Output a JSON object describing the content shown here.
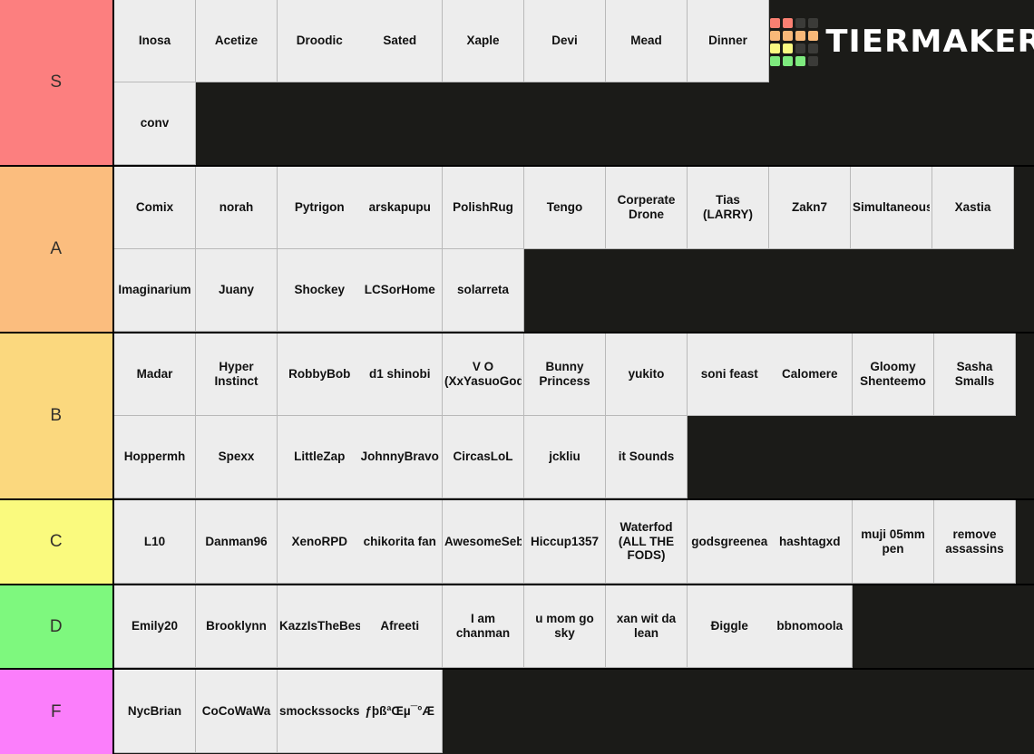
{
  "app": {
    "name": "TierMaker",
    "logo_word": "TIERMAKER",
    "background_color": "#1b1b18",
    "cell_color": "#ededed",
    "logo_icon": "tiermaker-grid-logo"
  },
  "logo_grid_colors": [
    "#fa8072",
    "#fa8072",
    "#3b3b38",
    "#3b3b38",
    "#f8b878",
    "#f8b878",
    "#f8b878",
    "#f8b878",
    "#fafa82",
    "#fafa82",
    "#3b3b38",
    "#3b3b38",
    "#7eea7e",
    "#7eea7e",
    "#7eea7e",
    "#3b3b38"
  ],
  "tiers": [
    {
      "label": "S",
      "color": "#fc7f7f",
      "rows": [
        [
          {
            "text": "Inosa",
            "span": 1
          },
          {
            "text": "Acetize",
            "span": 1
          },
          {
            "text": "Droodic",
            "span": 1
          },
          {
            "text": "Sated",
            "span": 1
          },
          {
            "text": "Xaple",
            "span": 1
          },
          {
            "text": "Devi",
            "span": 1
          },
          {
            "text": "Mead",
            "span": 1
          },
          {
            "text": "Dinner",
            "span": 1
          }
        ],
        [
          {
            "text": "conv",
            "span": 1
          }
        ]
      ]
    },
    {
      "label": "A",
      "color": "#fbbd7e",
      "rows": [
        [
          {
            "text": "Comix",
            "span": 1
          },
          {
            "text": "norah",
            "span": 1
          },
          {
            "text": "Pytrigon",
            "span": 1
          },
          {
            "text": "arskapupu",
            "span": 1
          },
          {
            "text": "PolishRug",
            "span": 1
          },
          {
            "text": "Tengo",
            "span": 1
          },
          {
            "text": "Corperate Drone",
            "span": 1
          },
          {
            "text": "Tias (LARRY)",
            "span": 1
          },
          {
            "text": "Zakn7",
            "span": 1
          },
          {
            "text": "Simultaneous",
            "span": 1
          },
          {
            "text": "Xastia",
            "span": 1
          }
        ],
        [
          {
            "text": "Imaginarium",
            "span": 1
          },
          {
            "text": "Juany",
            "span": 1
          },
          {
            "text": "Shockey",
            "span": 1
          },
          {
            "text": "LCSorHome",
            "span": 1
          },
          {
            "text": "solarreta",
            "span": 1
          }
        ]
      ]
    },
    {
      "label": "B",
      "color": "#fbd87e",
      "rows": [
        [
          {
            "text": "Madar",
            "span": 1
          },
          {
            "text": "Hyper Instinct",
            "span": 1
          },
          {
            "text": "RobbyBob",
            "span": 1
          },
          {
            "text": "d1 shinobi",
            "span": 1
          },
          {
            "text": "V O (XxYasuoGod",
            "span": 1
          },
          {
            "text": "Bunny Princess",
            "span": 1
          },
          {
            "text": "yukito",
            "span": 1
          },
          {
            "text": "soni feast",
            "span": 1
          },
          {
            "text": "Calomere",
            "span": 1
          },
          {
            "text": "Gloomy Shenteemo",
            "span": 1
          },
          {
            "text": "Sasha Smalls",
            "span": 1
          }
        ],
        [
          {
            "text": "Hoppermh",
            "span": 1
          },
          {
            "text": "Spexx",
            "span": 1
          },
          {
            "text": "LittleZap",
            "span": 1
          },
          {
            "text": "JohnnyBravo",
            "span": 1
          },
          {
            "text": "CircasLoL",
            "span": 1
          },
          {
            "text": "jckliu",
            "span": 1
          },
          {
            "text": "it Sounds",
            "span": 1
          }
        ]
      ]
    },
    {
      "label": "C",
      "color": "#fafa7e",
      "rows": [
        [
          {
            "text": "L10",
            "span": 1
          },
          {
            "text": "Danman96",
            "span": 1
          },
          {
            "text": "XenoRPD",
            "span": 1
          },
          {
            "text": "chikorita fan",
            "span": 1
          },
          {
            "text": "AwesomeSeb",
            "span": 1
          },
          {
            "text": "Hiccup1357",
            "span": 1
          },
          {
            "text": "Waterfod (ALL THE FODS)",
            "span": 1
          },
          {
            "text": "godsgreenea",
            "span": 1
          },
          {
            "text": "hashtagxd",
            "span": 1
          },
          {
            "text": "muji 05mm pen",
            "span": 1
          },
          {
            "text": "remove assassins",
            "span": 1
          }
        ]
      ]
    },
    {
      "label": "D",
      "color": "#7ef87e",
      "rows": [
        [
          {
            "text": "Emily20",
            "span": 1
          },
          {
            "text": "Brooklynn",
            "span": 1
          },
          {
            "text": "KazzIsTheBest",
            "span": 1
          },
          {
            "text": "Afreeti",
            "span": 1
          },
          {
            "text": "I am chanman",
            "span": 1
          },
          {
            "text": "u mom go sky",
            "span": 1
          },
          {
            "text": "xan wit da lean",
            "span": 1
          },
          {
            "text": "Điggle",
            "span": 1
          },
          {
            "text": "bbnomoola",
            "span": 1
          }
        ]
      ]
    },
    {
      "label": "F",
      "color": "#fb7efb",
      "rows": [
        [
          {
            "text": "NycBrian",
            "span": 1
          },
          {
            "text": "CoCoWaWa",
            "span": 1
          },
          {
            "text": "smockssocks",
            "span": 1
          },
          {
            "text": "ƒþßªŒµ¯°Æ",
            "span": 1
          }
        ]
      ]
    }
  ]
}
